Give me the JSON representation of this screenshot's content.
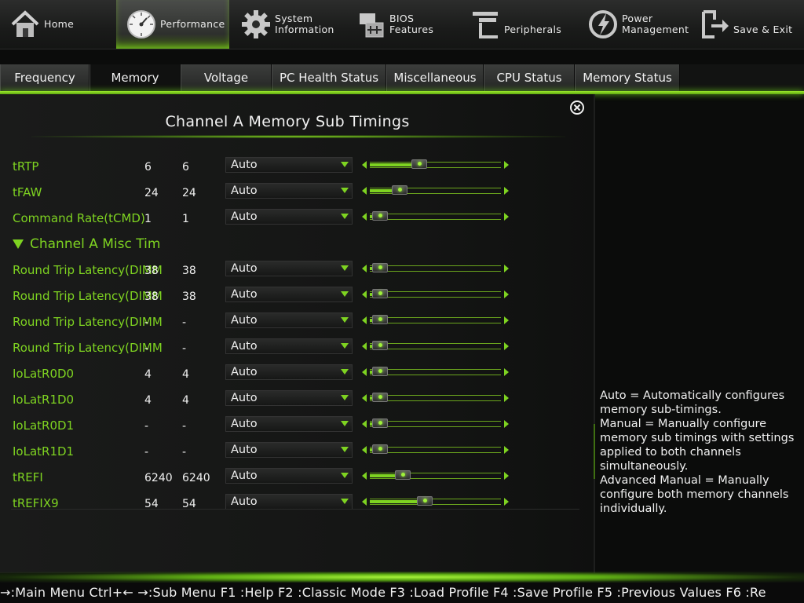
{
  "top_menu": [
    {
      "name": "home",
      "label": "Home",
      "icon": "house-icon",
      "active": false
    },
    {
      "name": "performance",
      "label": "Performance",
      "icon": "gauge-icon",
      "active": true
    },
    {
      "name": "system-information",
      "label": "System\nInformation",
      "icon": "gear-icon",
      "active": false
    },
    {
      "name": "bios-features",
      "label": "BIOS\nFeatures",
      "icon": "chip-icon",
      "active": false
    },
    {
      "name": "peripherals",
      "label": "Peripherals",
      "icon": "plug-icon",
      "active": false
    },
    {
      "name": "power-management",
      "label": "Power\nManagement",
      "icon": "power-icon",
      "active": false
    },
    {
      "name": "save-exit",
      "label": "Save & Exit",
      "icon": "exit-door-icon",
      "active": false
    }
  ],
  "tabs": [
    {
      "label": "Frequency",
      "active": false
    },
    {
      "label": "Memory",
      "active": true
    },
    {
      "label": "Voltage",
      "active": false
    },
    {
      "label": "PC Health Status",
      "active": false
    },
    {
      "label": "Miscellaneous",
      "active": false
    },
    {
      "label": "CPU Status",
      "active": false
    },
    {
      "label": "Memory Status",
      "active": false
    }
  ],
  "panel": {
    "title": "Channel A Memory Sub Timings",
    "section_label": "Channel A Misc Tim",
    "rows_before": [
      {
        "label": "tRTP",
        "v1": "6",
        "v2": "6",
        "dropdown": "Auto",
        "slider": 0.38
      },
      {
        "label": "tFAW",
        "v1": "24",
        "v2": "24",
        "dropdown": "Auto",
        "slider": 0.23
      },
      {
        "label": "Command Rate(tCMD)",
        "v1": "1",
        "v2": "1",
        "dropdown": "Auto",
        "slider": 0.08
      }
    ],
    "rows_after": [
      {
        "label": "Round Trip Latency(DIMM",
        "v1": "38",
        "v2": "38",
        "dropdown": "Auto",
        "slider": 0.08
      },
      {
        "label": "Round Trip Latency(DIMM",
        "v1": "38",
        "v2": "38",
        "dropdown": "Auto",
        "slider": 0.08
      },
      {
        "label": "Round Trip Latency(DIMM",
        "v1": "-",
        "v2": "-",
        "dropdown": "Auto",
        "slider": 0.08
      },
      {
        "label": "Round Trip Latency(DIMM",
        "v1": "-",
        "v2": "-",
        "dropdown": "Auto",
        "slider": 0.08
      },
      {
        "label": "IoLatR0D0",
        "v1": "4",
        "v2": "4",
        "dropdown": "Auto",
        "slider": 0.08
      },
      {
        "label": "IoLatR1D0",
        "v1": "4",
        "v2": "4",
        "dropdown": "Auto",
        "slider": 0.08
      },
      {
        "label": "IoLatR0D1",
        "v1": "-",
        "v2": "-",
        "dropdown": "Auto",
        "slider": 0.08
      },
      {
        "label": "IoLatR1D1",
        "v1": "-",
        "v2": "-",
        "dropdown": "Auto",
        "slider": 0.08
      },
      {
        "label": "tREFI",
        "v1": "6240",
        "v2": "6240",
        "dropdown": "Auto",
        "slider": 0.25
      },
      {
        "label": "tREFIX9",
        "v1": "54",
        "v2": "54",
        "dropdown": "Auto",
        "slider": 0.42
      }
    ]
  },
  "help_text": "Auto = Automatically configures memory sub-timings.\nManual = Manually configure memory sub timings with settings applied to both channels simultaneously.\nAdvanced Manual = Manually configure both memory channels individually.",
  "footer_text": "→:Main Menu Ctrl+← →:Sub Menu F1 :Help F2 :Classic Mode F3 :Load Profile F4 :Save Profile F5 :Previous Values F6 :Re",
  "colors": {
    "accent": "#7ed321",
    "background": "#0b0c0b"
  }
}
